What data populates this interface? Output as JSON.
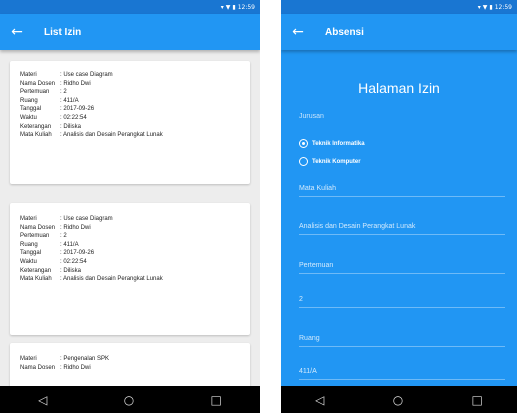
{
  "status_bar": {
    "icons": [
      "signal-icon",
      "wifi-icon",
      "battery-icon"
    ],
    "time": "12:59"
  },
  "left": {
    "app_bar": {
      "title": "List Izin"
    },
    "cards": [
      {
        "rows": [
          {
            "label": "Materi",
            "value": ": Use case Diagram"
          },
          {
            "label": "Nama Dosen",
            "value": ": Ridho Dwi"
          },
          {
            "label": "Pertemuan",
            "value": ": 2"
          },
          {
            "label": "Ruang",
            "value": ": 411/A"
          },
          {
            "label": "Tanggal",
            "value": ": 2017-09-26"
          },
          {
            "label": "Waktu",
            "value": ": 02:22:54"
          },
          {
            "label": "Keterangan",
            "value": ": Diliska"
          },
          {
            "label": "Mata Kuliah",
            "value": ": Analisis dan Desain Perangkat Lunak"
          }
        ]
      },
      {
        "rows": [
          {
            "label": "Materi",
            "value": ": Use case Diagram"
          },
          {
            "label": "Nama Dosen",
            "value": ": Ridho Dwi"
          },
          {
            "label": "Pertemuan",
            "value": ": 2"
          },
          {
            "label": "Ruang",
            "value": ": 411/A"
          },
          {
            "label": "Tanggal",
            "value": ": 2017-09-26"
          },
          {
            "label": "Waktu",
            "value": ": 02:22:54"
          },
          {
            "label": "Keterangan",
            "value": ": Diliska"
          },
          {
            "label": "Mata Kuliah",
            "value": ": Analisis dan Desain Perangkat Lunak"
          }
        ]
      },
      {
        "rows": [
          {
            "label": "Materi",
            "value": ": Pengenalan SPK"
          },
          {
            "label": "Nama Dosen",
            "value": ": Ridho Dwi"
          }
        ]
      }
    ]
  },
  "right": {
    "app_bar": {
      "title": "Absensi"
    },
    "heading": "Halaman Izin",
    "jurusan_label": "Jurusan",
    "radio_options": [
      {
        "label": "Teknik Informatika",
        "selected": true
      },
      {
        "label": "Teknik Komputer",
        "selected": false
      }
    ],
    "fields": [
      {
        "label": "Mata Kuliah",
        "value": "Analisis dan Desain Perangkat Lunak"
      },
      {
        "label": "Pertemuan",
        "value": "2"
      },
      {
        "label": "Ruang",
        "value": "411/A"
      }
    ]
  },
  "nav_bar": {
    "back": "◁",
    "home": "○",
    "recents": "□"
  },
  "colors": {
    "primary": "#2196f3",
    "primary_dark": "#1976d2",
    "background": "#ededed"
  }
}
